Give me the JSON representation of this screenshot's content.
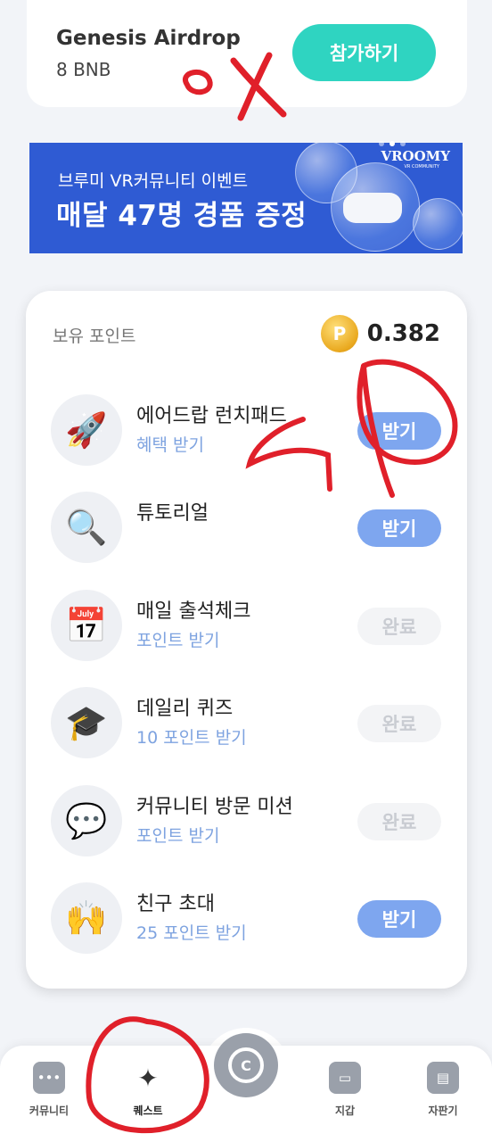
{
  "airdrop": {
    "title": "Genesis Airdrop",
    "amount": "8 BNB",
    "join_label": "참가하기"
  },
  "banner": {
    "subtitle": "브루미 VR커뮤니티 이벤트",
    "headline": "매달 47명 경품 증정",
    "brand": "VROOMY",
    "brand_sub": "VR COMMUNITY",
    "dots": 3,
    "active_dot": 2
  },
  "points": {
    "label": "보유 포인트",
    "coin_symbol": "P",
    "value": "0.382"
  },
  "tasks": [
    {
      "name": "에어드랍 런치패드",
      "sub": "혜택 받기",
      "button": "받기",
      "state": "receive",
      "icon": "rocket-icon"
    },
    {
      "name": "튜토리얼",
      "sub": "",
      "button": "받기",
      "state": "receive",
      "icon": "magnifier-icon"
    },
    {
      "name": "매일 출석체크",
      "sub": "포인트 받기",
      "button": "완료",
      "state": "done",
      "icon": "calendar-icon"
    },
    {
      "name": "데일리 퀴즈",
      "sub": "10 포인트 받기",
      "button": "완료",
      "state": "done",
      "icon": "graduation-cap-icon"
    },
    {
      "name": "커뮤니티 방문 미션",
      "sub": "포인트 받기",
      "button": "완료",
      "state": "done",
      "icon": "chat-bubble-icon"
    },
    {
      "name": "친구 초대",
      "sub": "25 포인트 받기",
      "button": "받기",
      "state": "receive",
      "icon": "handshake-icon"
    }
  ],
  "nav": {
    "community": "커뮤니티",
    "quest": "퀘스트",
    "center_symbol": "C",
    "wallet": "지갑",
    "vending": "자판기"
  },
  "colors": {
    "accent_teal": "#2fd4c1",
    "banner_blue": "#2f5bd3",
    "receive_button": "#7ea6ef",
    "annotation_red": "#e0202a"
  }
}
